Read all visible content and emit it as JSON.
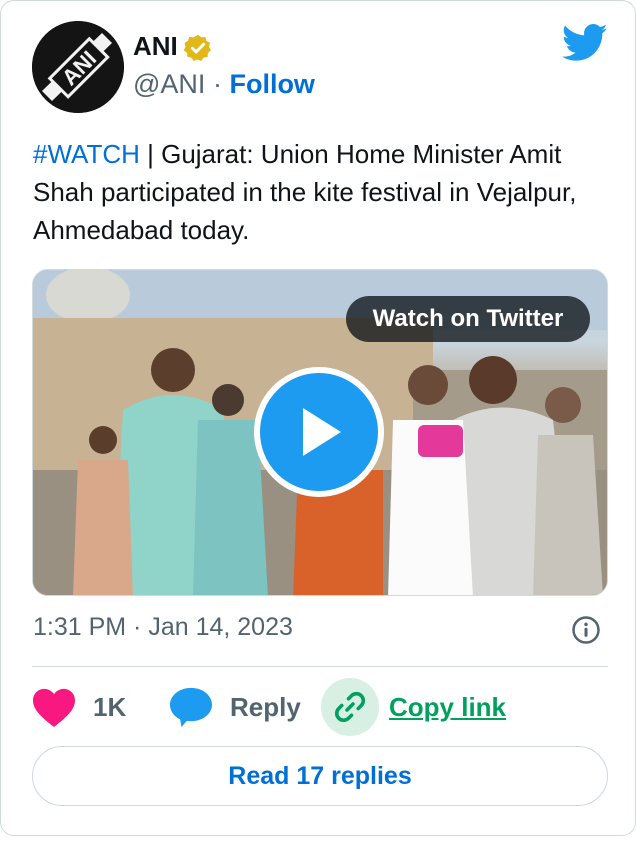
{
  "author": {
    "display_name": "ANI",
    "handle": "@ANI",
    "separator": "·",
    "follow_label": "Follow",
    "avatar_text": "ANI"
  },
  "tweet": {
    "hashtag": "#WATCH",
    "text": " | Gujarat: Union Home Minister Amit Shah participated in the kite festival in Vejalpur, Ahmedabad today."
  },
  "media": {
    "watch_label": "Watch on Twitter"
  },
  "meta": {
    "timestamp": "1:31 PM · Jan 14, 2023"
  },
  "actions": {
    "like_count": "1K",
    "reply_label": "Reply",
    "copy_link_label": "Copy link",
    "read_replies_label": "Read 17 replies"
  },
  "colors": {
    "link_blue": "#006fd6",
    "twitter_blue": "#1d9bf0",
    "like_pink": "#f91880",
    "copy_green": "#00a05e",
    "verified_gold": "#e2b719"
  },
  "icons": [
    "ani-logo",
    "verified-badge-icon",
    "twitter-bird-icon",
    "play-icon",
    "info-icon",
    "heart-icon",
    "reply-bubble-icon",
    "link-icon"
  ]
}
